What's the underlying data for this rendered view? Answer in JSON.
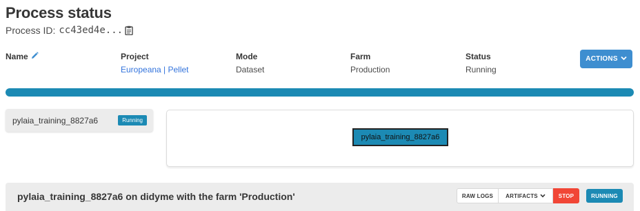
{
  "header": {
    "title": "Process status",
    "process_id_label": "Process ID:",
    "process_id_value": "cc43ed4e...",
    "copy_icon": "clipboard-icon"
  },
  "info": {
    "name_label": "Name",
    "edit_icon": "pencil-icon",
    "project_label": "Project",
    "project_value": "Europeana | Pellet",
    "mode_label": "Mode",
    "mode_value": "Dataset",
    "farm_label": "Farm",
    "farm_value": "Production",
    "status_label": "Status",
    "status_value": "Running"
  },
  "actions": {
    "label": "ACTIONS",
    "icon": "chevron-down-icon"
  },
  "progress": {
    "fraction": 1.0
  },
  "run": {
    "name": "pylaia_training_8827a6",
    "state": "Running"
  },
  "graph": {
    "node_label": "pylaia_training_8827a6"
  },
  "task": {
    "title": "pylaia_training_8827a6 on didyme with the farm 'Production'",
    "raw_logs_label": "RAW LOGS",
    "artifacts_label": "ARTIFACTS",
    "stop_label": "STOP",
    "state_label": "RUNNING"
  },
  "colors": {
    "accent": "#1c8ab4",
    "action_button": "#3e8ed0",
    "stop": "#f14636",
    "link": "#3273dc"
  }
}
